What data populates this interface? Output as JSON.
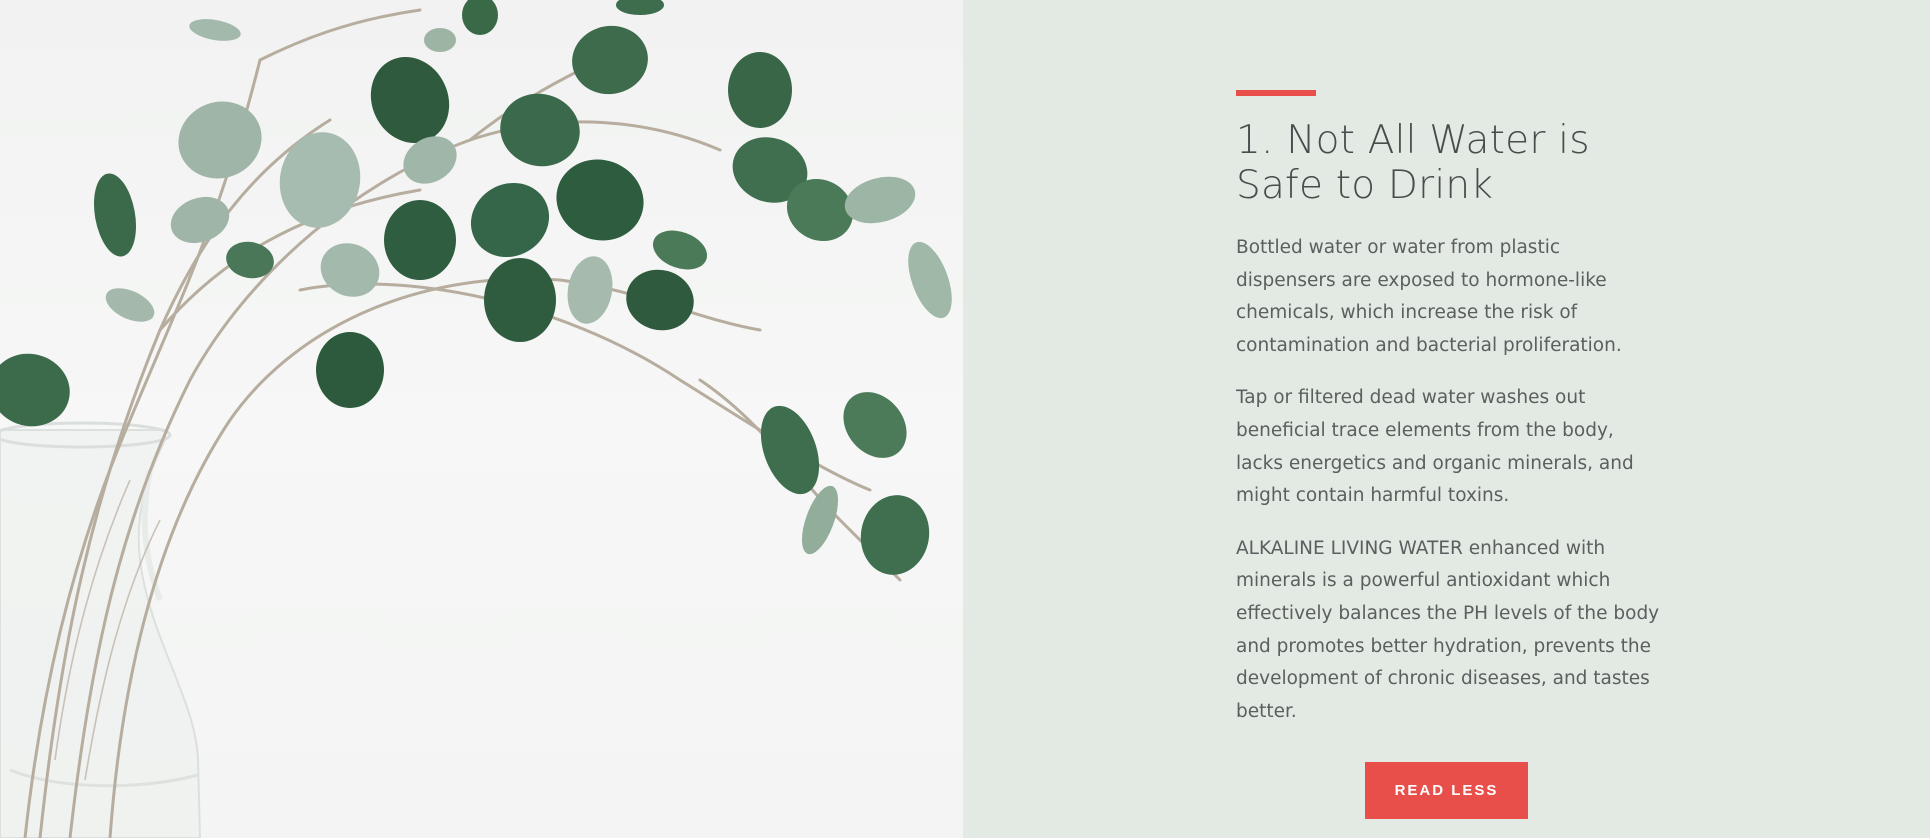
{
  "article": {
    "heading": "1. Not All Water is Safe to Drink",
    "paragraphs": [
      "Bottled water or water from plastic dispensers are exposed to hormone-like chemicals, which increase the risk of contamination and bacterial proliferation.",
      "Tap or filtered dead water washes out beneficial trace elements from the body, lacks energetics and organic minerals, and might contain harmful toxins.",
      "ALKALINE LIVING WATER  enhanced with minerals is a powerful antioxidant which effectively balances the PH levels of the body and promotes better hydration, prevents the development of chronic diseases, and tastes better."
    ],
    "button_label": "READ LESS"
  },
  "colors": {
    "accent": "#e84e4a",
    "panel_background": "#e3e9e3",
    "heading_text": "#474c4c",
    "body_text": "#5a5f5f"
  },
  "image": {
    "subject": "eucalyptus-branches-in-glass-vase"
  }
}
